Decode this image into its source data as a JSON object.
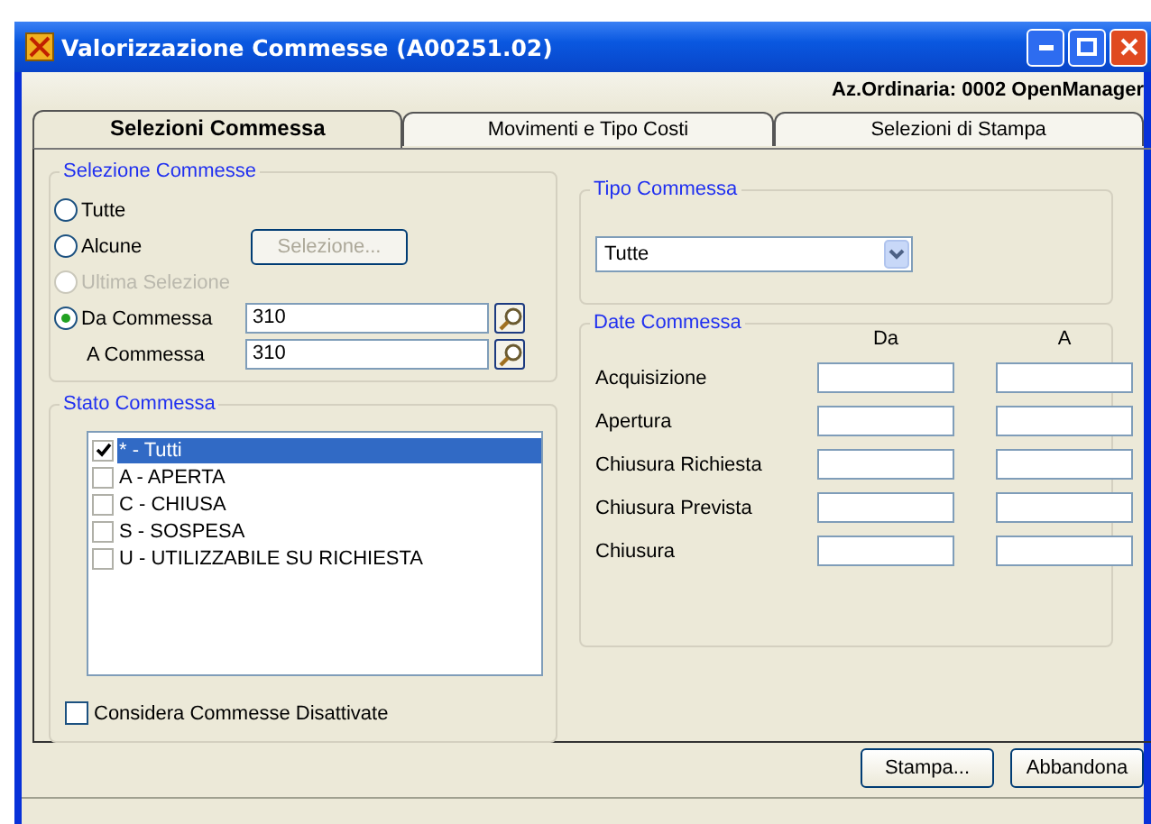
{
  "window": {
    "title": "Valorizzazione Commesse (A00251.02)"
  },
  "company": "Az.Ordinaria: 0002 OpenManager",
  "tabs": [
    {
      "label": "Selezioni Commessa",
      "selected": true
    },
    {
      "label": "Movimenti e Tipo Costi",
      "selected": false
    },
    {
      "label": "Selezioni di Stampa",
      "selected": false
    }
  ],
  "selezione_commesse": {
    "title": "Selezione Commesse",
    "options": [
      {
        "label": "Tutte",
        "selected": false,
        "disabled": false
      },
      {
        "label": "Alcune",
        "selected": false,
        "disabled": false
      },
      {
        "label": "Ultima Selezione",
        "selected": false,
        "disabled": true
      },
      {
        "label": "Da Commessa",
        "selected": true,
        "disabled": false
      }
    ],
    "selezione_button": {
      "label": "Selezione...",
      "disabled": true
    },
    "da_value": "310",
    "a_label": "A Commessa",
    "a_value": "310"
  },
  "stato_commessa": {
    "title": "Stato Commessa",
    "items": [
      {
        "label": "* - Tutti",
        "checked": true,
        "selected": true
      },
      {
        "label": "A - APERTA",
        "checked": false,
        "selected": false
      },
      {
        "label": "C - CHIUSA",
        "checked": false,
        "selected": false
      },
      {
        "label": "S - SOSPESA",
        "checked": false,
        "selected": false
      },
      {
        "label": "U - UTILIZZABILE SU RICHIESTA",
        "checked": false,
        "selected": false
      }
    ],
    "disattivate": {
      "label": "Considera Commesse Disattivate",
      "checked": false
    }
  },
  "tipo_commessa": {
    "title": "Tipo Commessa",
    "value": "Tutte"
  },
  "date_commessa": {
    "title": "Date Commessa",
    "col_from": "Da",
    "col_to": "A",
    "rows": [
      "Acquisizione",
      "Apertura",
      "Chiusura Richiesta",
      "Chiusura Prevista",
      "Chiusura"
    ]
  },
  "buttons": [
    "Stampa...",
    "Abbandona"
  ]
}
